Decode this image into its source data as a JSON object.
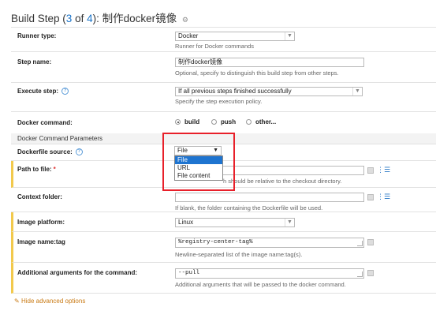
{
  "header": {
    "title_prefix": "Build Step (",
    "step_current": "3",
    "of_word": " of ",
    "step_total": "4",
    "title_suffix": "): 制作docker镜像",
    "settings_icon": "gear-icon"
  },
  "runner_type": {
    "label": "Runner type:",
    "value": "Docker",
    "hint": "Runner for Docker commands"
  },
  "step_name": {
    "label": "Step name:",
    "value": "制作docker镜像",
    "hint": "Optional, specify to distinguish this build step from other steps."
  },
  "execute_step": {
    "label": "Execute step:",
    "value": "If all previous steps finished successfully",
    "hint": "Specify the step execution policy."
  },
  "docker_command": {
    "label": "Docker command:",
    "options": [
      "build",
      "push",
      "other..."
    ],
    "selected": "build"
  },
  "section": {
    "title": "Docker Command Parameters"
  },
  "dockerfile_source": {
    "label": "Dockerfile source:",
    "value": "File",
    "options": [
      "File",
      "URL",
      "File content"
    ]
  },
  "path_to_file": {
    "label": "Path to file:",
    "required_mark": "*",
    "hint_visible": "h should be relative to the checkout directory."
  },
  "context_folder": {
    "label": "Context folder:",
    "hint": "If blank, the folder containing the Dockerfile will be used."
  },
  "image_platform": {
    "label": "Image platform:",
    "value": "Linux"
  },
  "image_name_tag": {
    "label": "Image name:tag",
    "value": "%registry-center-tag%",
    "hint": "Newline-separated list of the image name:tag(s)."
  },
  "additional_args": {
    "label": "Additional arguments for the command:",
    "value": "--pull",
    "hint": "Additional arguments that will be passed to the docker command."
  },
  "footer": {
    "hide_advanced": "Hide advanced options"
  },
  "colors": {
    "accent_blue": "#1a73c8",
    "highlight_red": "#e8202a",
    "selected_bg": "#1e74d0",
    "advanced_link": "#c97a14"
  }
}
